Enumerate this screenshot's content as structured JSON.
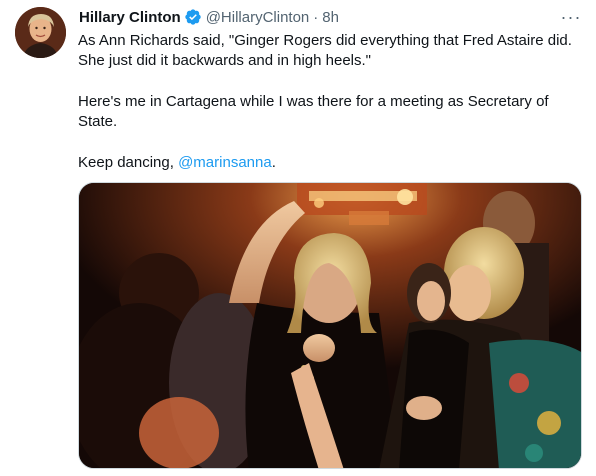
{
  "author": {
    "name": "Hillary Clinton",
    "handle": "@HillaryClinton",
    "separator": "·",
    "time": "8h",
    "verified_icon": "verified-badge-icon",
    "avatar_icon": "avatar-photo"
  },
  "tweet": {
    "line1": "As Ann Richards said, \"Ginger Rogers did everything that Fred Astaire did.",
    "line2": "She just did it backwards and in high heels.\"",
    "line3": "Here's me in Cartagena while I was there for a meeting as Secretary of",
    "line4": "State.",
    "line5_prefix": "Keep dancing, ",
    "mention": "@marinsanna",
    "line5_suffix": "."
  },
  "more_button": {
    "label": "···",
    "icon": "more-icon"
  },
  "media": {
    "icon": "photo-dancing-cartagena"
  },
  "colors": {
    "accent": "#1d9bf0",
    "secondary_text": "#536471",
    "primary_text": "#0f1419"
  }
}
